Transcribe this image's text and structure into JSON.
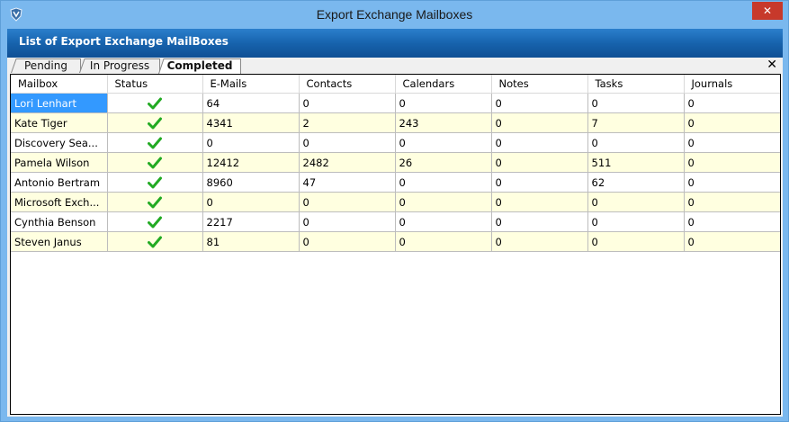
{
  "window": {
    "title": "Export Exchange Mailboxes",
    "close_label": "✕"
  },
  "header": {
    "title": "List of Export Exchange MailBoxes"
  },
  "tabs": [
    {
      "label": "Pending"
    },
    {
      "label": "In Progress"
    },
    {
      "label": "Completed"
    }
  ],
  "tab_close": "✕",
  "columns": [
    "Mailbox",
    "Status",
    "E-Mails",
    "Contacts",
    "Calendars",
    "Notes",
    "Tasks",
    "Journals"
  ],
  "rows": [
    {
      "mailbox": "Lori Lenhart",
      "emails": "64",
      "contacts": "0",
      "calendars": "0",
      "notes": "0",
      "tasks": "0",
      "journals": "0"
    },
    {
      "mailbox": "Kate Tiger",
      "emails": "4341",
      "contacts": "2",
      "calendars": "243",
      "notes": "0",
      "tasks": "7",
      "journals": "0"
    },
    {
      "mailbox": "Discovery Sea...",
      "emails": "0",
      "contacts": "0",
      "calendars": "0",
      "notes": "0",
      "tasks": "0",
      "journals": "0"
    },
    {
      "mailbox": "Pamela Wilson",
      "emails": "12412",
      "contacts": "2482",
      "calendars": "26",
      "notes": "0",
      "tasks": "511",
      "journals": "0"
    },
    {
      "mailbox": "Antonio Bertram",
      "emails": "8960",
      "contacts": "47",
      "calendars": "0",
      "notes": "0",
      "tasks": "62",
      "journals": "0"
    },
    {
      "mailbox": "Microsoft Exch...",
      "emails": "0",
      "contacts": "0",
      "calendars": "0",
      "notes": "0",
      "tasks": "0",
      "journals": "0"
    },
    {
      "mailbox": "Cynthia Benson",
      "emails": "2217",
      "contacts": "0",
      "calendars": "0",
      "notes": "0",
      "tasks": "0",
      "journals": "0"
    },
    {
      "mailbox": "Steven Janus",
      "emails": "81",
      "contacts": "0",
      "calendars": "0",
      "notes": "0",
      "tasks": "0",
      "journals": "0"
    }
  ],
  "colors": {
    "check": "#22aa22",
    "selection": "#3399ff",
    "header": "#1763ad"
  }
}
